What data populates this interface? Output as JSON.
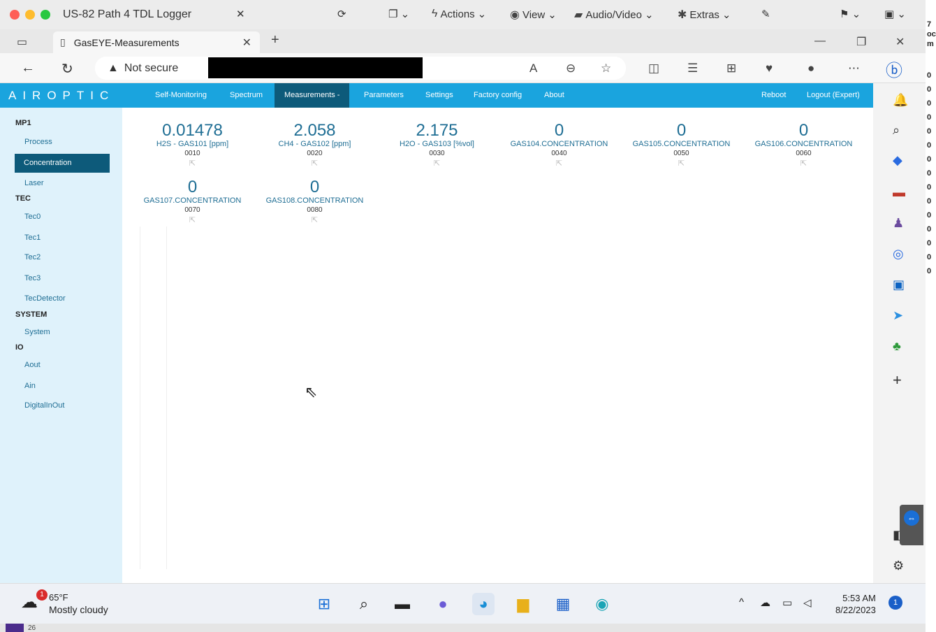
{
  "mac": {
    "title": "US-82 Path 4 TDL Logger",
    "actions": "Actions",
    "view": "View",
    "audio_video": "Audio/Video",
    "extras": "Extras"
  },
  "browser": {
    "tab_title": "GasEYE-Measurements",
    "url_label": "Not secure"
  },
  "app": {
    "logo": "AIROPTIC",
    "nav": [
      "Self-Monitoring",
      "Spectrum",
      "Measurements -",
      "Parameters",
      "Settings",
      "Factory config",
      "About"
    ],
    "reboot": "Reboot",
    "logout": "Logout (Expert)"
  },
  "sidebar": {
    "groups": [
      {
        "title": "MP1",
        "items": [
          "Process",
          "Concentration",
          "Laser"
        ]
      },
      {
        "title": "TEC",
        "items": [
          "Tec0",
          "Tec1",
          "Tec2",
          "Tec3",
          "TecDetector"
        ]
      },
      {
        "title": "SYSTEM",
        "items": [
          "System"
        ]
      },
      {
        "title": "IO",
        "items": [
          "Aout",
          "Ain",
          "DigitalInOut"
        ]
      }
    ],
    "active": "Concentration"
  },
  "measurements": [
    {
      "value": "0.01478",
      "name": "H2S - GAS101 [ppm]",
      "code": "0010"
    },
    {
      "value": "2.058",
      "name": "CH4 - GAS102 [ppm]",
      "code": "0020"
    },
    {
      "value": "2.175",
      "name": "H2O - GAS103 [%vol]",
      "code": "0030"
    },
    {
      "value": "0",
      "name": "GAS104.CONCENTRATION",
      "code": "0040"
    },
    {
      "value": "0",
      "name": "GAS105.CONCENTRATION",
      "code": "0050"
    },
    {
      "value": "0",
      "name": "GAS106.CONCENTRATION",
      "code": "0060"
    },
    {
      "value": "0",
      "name": "GAS107.CONCENTRATION",
      "code": "0070"
    },
    {
      "value": "0",
      "name": "GAS108.CONCENTRATION",
      "code": "0080"
    }
  ],
  "taskbar": {
    "temp": "65°F",
    "weather": "Mostly cloudy",
    "weather_badge": "1",
    "time": "5:53 AM",
    "date": "8/22/2023",
    "notif_count": "1"
  },
  "misc": {
    "strip_number": "26"
  },
  "edge_chars": [
    "7",
    "oc",
    "m",
    "0",
    "0",
    "0",
    "0",
    "0",
    "0",
    "0",
    "0",
    "0",
    "0",
    "0",
    "0",
    "0",
    "0",
    "0"
  ]
}
